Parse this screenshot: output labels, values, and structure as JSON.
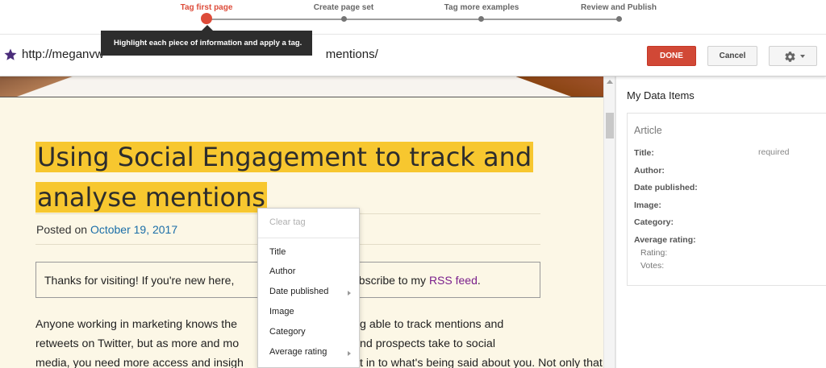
{
  "stepper": {
    "steps": [
      {
        "label": "Tag first page"
      },
      {
        "label": "Create page set"
      },
      {
        "label": "Tag more examples"
      },
      {
        "label": "Review and Publish"
      }
    ]
  },
  "tooltip": {
    "text": "Highlight each piece of information and apply a tag."
  },
  "toolbar": {
    "url_visible_start": "http://meganvw",
    "url_visible_end": "mentions/",
    "done_label": "DONE",
    "cancel_label": "Cancel",
    "settings_icon": "gear-icon",
    "favorite_icon": "star-icon"
  },
  "webpage": {
    "title_line1": "Using Social Engagement to track and",
    "title_line2": "analyse mentions",
    "posted_prefix": "Posted on ",
    "posted_date": "October 19, 2017",
    "notice_left": "Thanks for visiting! If you're new here,",
    "notice_right_prefix": "ubscribe to my ",
    "notice_rss": "RSS feed",
    "notice_suffix": ".",
    "para_l1a": "Anyone working in marketing knows the",
    "para_l1b": "g able to track mentions and",
    "para_l2a": "retweets on Twitter, but as more and mo",
    "para_l2b": "nd prospects take to social",
    "para_l3a": "media, you need more access and insigh",
    "para_l3b": "t in to what's being said about you. Not only that,"
  },
  "context_menu": {
    "clear": "Clear tag",
    "items": [
      "Title",
      "Author",
      "Date published",
      "Image",
      "Category",
      "Average rating"
    ]
  },
  "panel": {
    "title": "My Data Items",
    "card_title": "Article",
    "fields": [
      "Title:",
      "Author:",
      "Date published:",
      "Image:",
      "Category:",
      "Average rating:"
    ],
    "required": "required",
    "subfields": [
      "Rating:",
      "Votes:"
    ]
  },
  "colors": {
    "accent_red": "#dd4b39",
    "done_button": "#d14836",
    "title_highlight": "#f7c72f",
    "link_blue": "#1b6ea8",
    "rss_purple": "#7a1f8c",
    "page_background": "#fcf7e6"
  }
}
